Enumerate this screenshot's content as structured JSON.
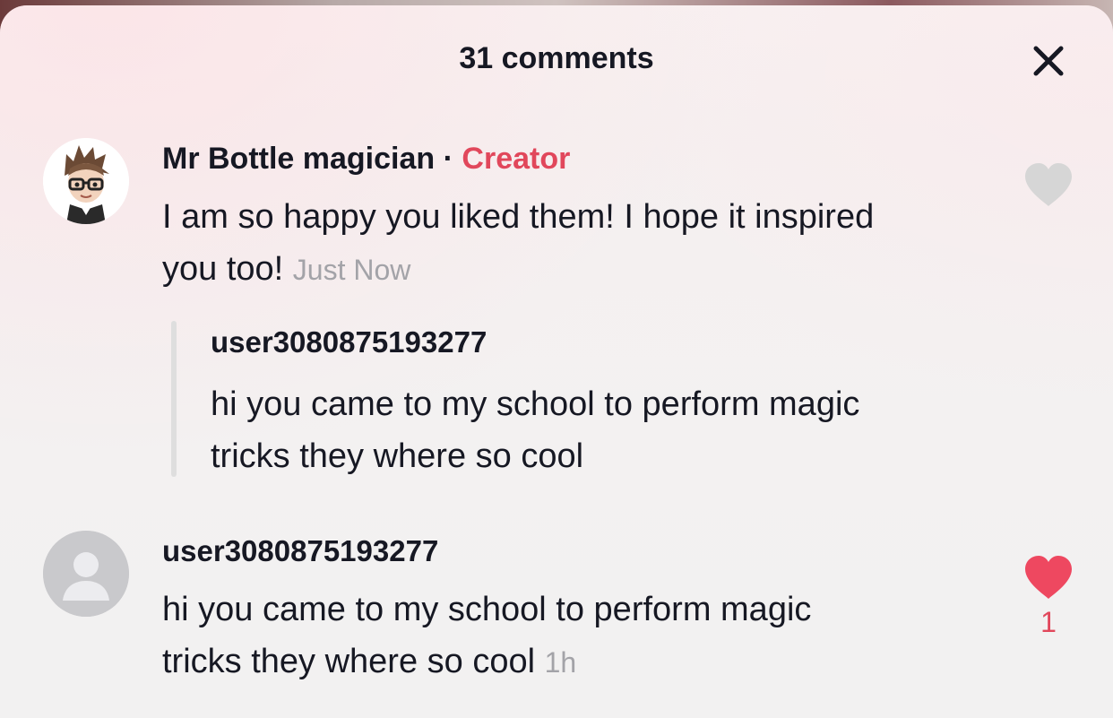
{
  "header": {
    "title": "31 comments",
    "close_icon": "close-icon"
  },
  "comments": [
    {
      "username": "Mr Bottle magician",
      "separator": "·",
      "badge": "Creator",
      "text_line1": "I am so happy you liked them! I hope it inspired",
      "text_line2": "you too!",
      "time": "Just Now",
      "liked": false,
      "like_icon": "heart-outline-icon",
      "reply_to": {
        "username": "user3080875193277",
        "text_line1": "hi you came to my school to perform magic",
        "text_line2": "tricks they where so cool"
      }
    },
    {
      "username": "user3080875193277",
      "text_line1": "hi you came to my school to perform magic",
      "text_line2": "tricks they where so cool",
      "time": "1h",
      "liked": true,
      "like_icon": "heart-filled-icon",
      "like_count": "1"
    }
  ],
  "colors": {
    "accent": "#e1475b",
    "text": "#161823",
    "muted": "#a3a3a8",
    "heart_inactive": "#d6d6d6"
  }
}
